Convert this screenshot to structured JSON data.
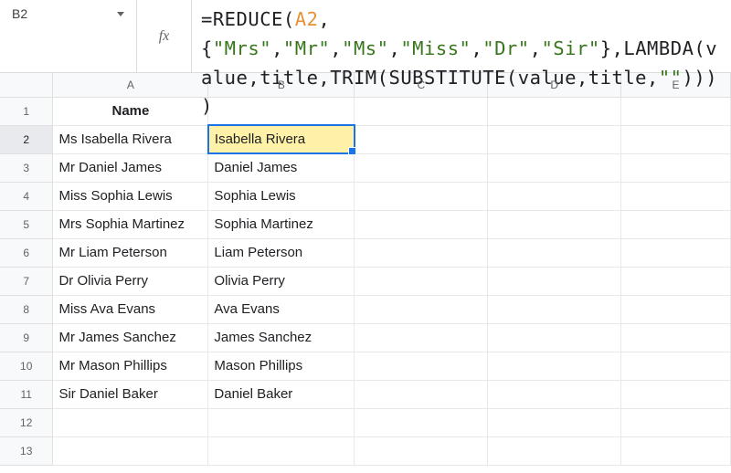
{
  "nameBox": {
    "value": "B2"
  },
  "fxLabel": "fx",
  "formula": {
    "parts": [
      {
        "t": "=REDUCE(",
        "c": "plain"
      },
      {
        "t": "A2",
        "c": "ref"
      },
      {
        "t": ",{",
        "c": "plain"
      },
      {
        "t": "\"Mrs\"",
        "c": "str"
      },
      {
        "t": ",",
        "c": "plain"
      },
      {
        "t": "\"Mr\"",
        "c": "str"
      },
      {
        "t": ",",
        "c": "plain"
      },
      {
        "t": "\"Ms\"",
        "c": "str"
      },
      {
        "t": ",",
        "c": "plain"
      },
      {
        "t": "\"Miss\"",
        "c": "str"
      },
      {
        "t": ",",
        "c": "plain"
      },
      {
        "t": "\"Dr\"",
        "c": "str"
      },
      {
        "t": ",",
        "c": "plain"
      },
      {
        "t": "\"Sir\"",
        "c": "str"
      },
      {
        "t": "},LAMBDA(value,title,TRIM(SUBSTITUTE(value,title,",
        "c": "plain"
      },
      {
        "t": "\"\"",
        "c": "str"
      },
      {
        "t": "))))",
        "c": "plain"
      }
    ]
  },
  "columns": [
    "A",
    "B",
    "C",
    "D",
    "E"
  ],
  "rowCount": 13,
  "selectedCell": {
    "row": 2,
    "col": "B"
  },
  "header": {
    "A": "Name"
  },
  "data": [
    {
      "A": "Ms Isabella Rivera",
      "B": "Isabella Rivera"
    },
    {
      "A": "Mr Daniel James",
      "B": "Daniel James"
    },
    {
      "A": "Miss Sophia Lewis",
      "B": "Sophia Lewis"
    },
    {
      "A": "Mrs Sophia Martinez",
      "B": "Sophia Martinez"
    },
    {
      "A": "Mr Liam Peterson",
      "B": "Liam Peterson"
    },
    {
      "A": "Dr Olivia Perry",
      "B": "Olivia Perry"
    },
    {
      "A": "Miss Ava Evans",
      "B": "Ava Evans"
    },
    {
      "A": "Mr James Sanchez",
      "B": "James Sanchez"
    },
    {
      "A": "Mr Mason Phillips",
      "B": "Mason Phillips"
    },
    {
      "A": "Sir Daniel Baker",
      "B": "Daniel Baker"
    }
  ]
}
